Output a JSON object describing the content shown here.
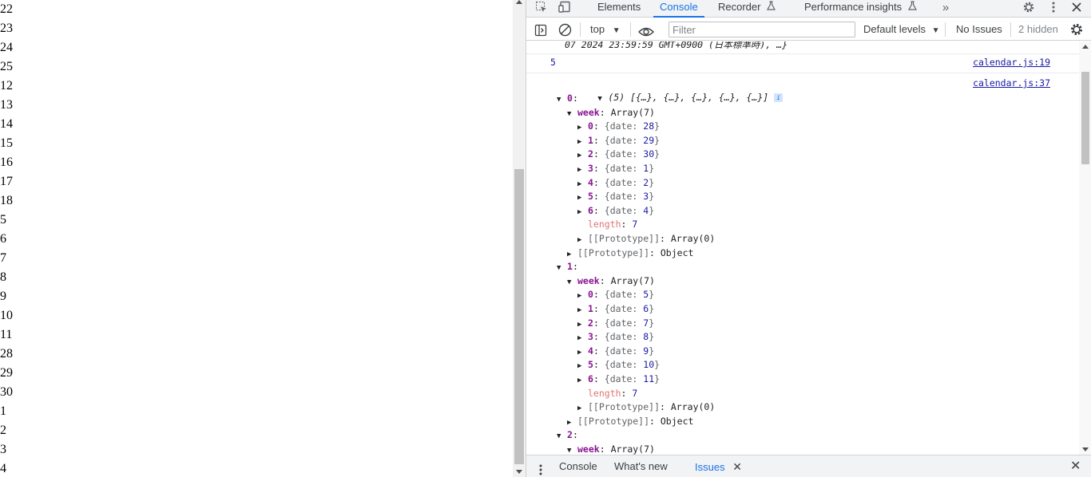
{
  "page": {
    "lines": [
      "22",
      "23",
      "24",
      "25",
      "12",
      "13",
      "14",
      "15",
      "16",
      "17",
      "18",
      "5",
      "6",
      "7",
      "8",
      "9",
      "10",
      "11",
      "28",
      "29",
      "30",
      "1",
      "2",
      "3",
      "4"
    ]
  },
  "devtools": {
    "tabs": [
      {
        "label": "Elements",
        "active": false
      },
      {
        "label": "Console",
        "active": true
      },
      {
        "label": "Recorder",
        "active": false
      },
      {
        "label": "Performance insights",
        "active": false
      }
    ],
    "more_tabs": "»",
    "toolbar": {
      "context": "top",
      "filter_placeholder": "Filter",
      "levels": "Default levels",
      "issues": "No Issues",
      "hidden": "2 hidden"
    },
    "console": {
      "first_line": "07 2024 23:59:59 GMT+0900 (日本標準時), …}",
      "msg1": {
        "value": "5",
        "source": "calendar.js:19"
      },
      "msg2": {
        "summary": "(5) [{…}, {…}, {…}, {…}, {…}]",
        "info": "i",
        "source": "calendar.js:37"
      },
      "tree": [
        {
          "indent": 1,
          "arrow": "▼",
          "key": "0",
          "text": ""
        },
        {
          "indent": 2,
          "arrow": "▼",
          "key": "week",
          "text": "Array(7)"
        },
        {
          "indent": 3,
          "arrow": "▶",
          "key": "0",
          "brace": "{date: ",
          "val": "28"
        },
        {
          "indent": 3,
          "arrow": "▶",
          "key": "1",
          "brace": "{date: ",
          "val": "29"
        },
        {
          "indent": 3,
          "arrow": "▶",
          "key": "2",
          "brace": "{date: ",
          "val": "30"
        },
        {
          "indent": 3,
          "arrow": "▶",
          "key": "3",
          "brace": "{date: ",
          "val": "1"
        },
        {
          "indent": 3,
          "arrow": "▶",
          "key": "4",
          "brace": "{date: ",
          "val": "2"
        },
        {
          "indent": 3,
          "arrow": "▶",
          "key": "5",
          "brace": "{date: ",
          "val": "3"
        },
        {
          "indent": 3,
          "arrow": "▶",
          "key": "6",
          "brace": "{date: ",
          "val": "4"
        },
        {
          "indent": 3,
          "arrow": "",
          "pkey": "length",
          "val": "7"
        },
        {
          "indent": 3,
          "arrow": "▶",
          "proto": "[[Prototype]]",
          "text": "Array(0)"
        },
        {
          "indent": 2,
          "arrow": "▶",
          "proto": "[[Prototype]]",
          "text": "Object"
        },
        {
          "indent": 1,
          "arrow": "▼",
          "key": "1",
          "text": ""
        },
        {
          "indent": 2,
          "arrow": "▼",
          "key": "week",
          "text": "Array(7)"
        },
        {
          "indent": 3,
          "arrow": "▶",
          "key": "0",
          "brace": "{date: ",
          "val": "5"
        },
        {
          "indent": 3,
          "arrow": "▶",
          "key": "1",
          "brace": "{date: ",
          "val": "6"
        },
        {
          "indent": 3,
          "arrow": "▶",
          "key": "2",
          "brace": "{date: ",
          "val": "7"
        },
        {
          "indent": 3,
          "arrow": "▶",
          "key": "3",
          "brace": "{date: ",
          "val": "8"
        },
        {
          "indent": 3,
          "arrow": "▶",
          "key": "4",
          "brace": "{date: ",
          "val": "9"
        },
        {
          "indent": 3,
          "arrow": "▶",
          "key": "5",
          "brace": "{date: ",
          "val": "10"
        },
        {
          "indent": 3,
          "arrow": "▶",
          "key": "6",
          "brace": "{date: ",
          "val": "11"
        },
        {
          "indent": 3,
          "arrow": "",
          "pkey": "length",
          "val": "7"
        },
        {
          "indent": 3,
          "arrow": "▶",
          "proto": "[[Prototype]]",
          "text": "Array(0)"
        },
        {
          "indent": 2,
          "arrow": "▶",
          "proto": "[[Prototype]]",
          "text": "Object"
        },
        {
          "indent": 1,
          "arrow": "▼",
          "key": "2",
          "text": ""
        },
        {
          "indent": 2,
          "arrow": "▼",
          "key": "week",
          "text": "Array(7)"
        }
      ]
    },
    "drawer": {
      "tabs": [
        {
          "label": "Console",
          "active": false
        },
        {
          "label": "What's new",
          "active": false
        },
        {
          "label": "Issues",
          "active": true
        }
      ],
      "close": "×"
    },
    "colors": {
      "accent": "#1a73e8",
      "key": "#881391",
      "number": "#1a1aa6"
    }
  }
}
